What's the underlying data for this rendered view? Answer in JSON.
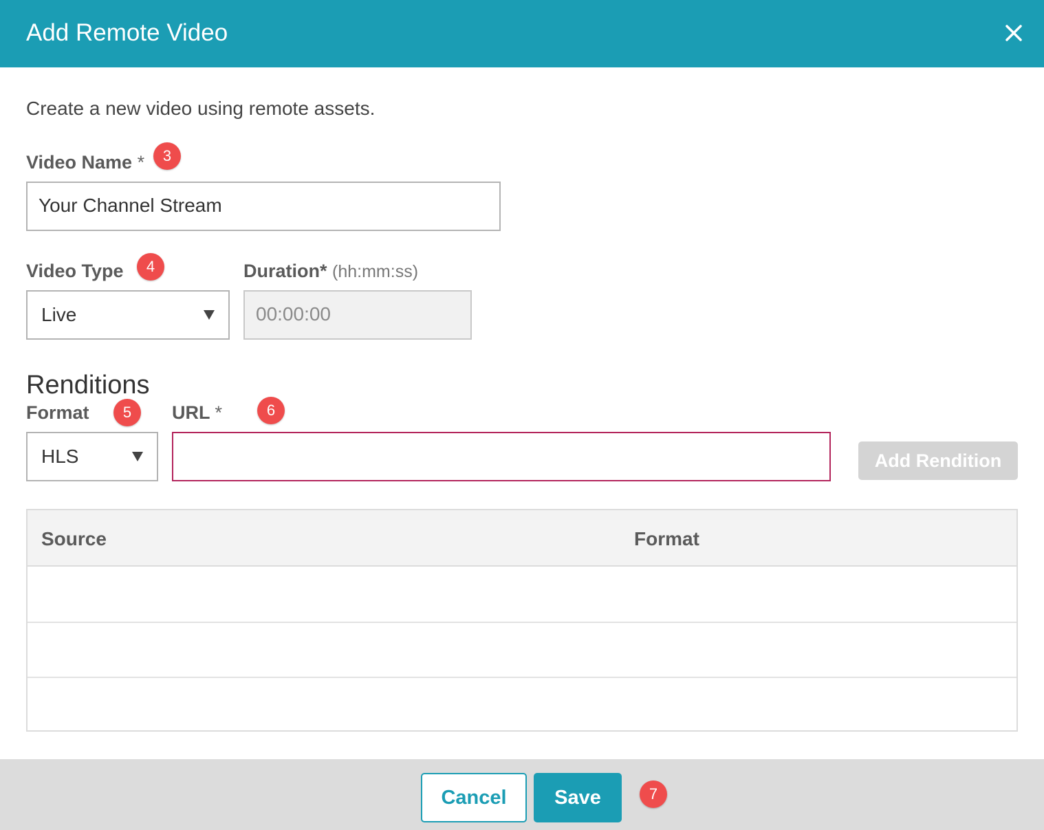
{
  "dialog": {
    "title": "Add Remote Video",
    "close_icon": "close-icon",
    "intro": "Create a new video using remote assets."
  },
  "video_name": {
    "label": "Video Name",
    "required_mark": "*",
    "badge": "3",
    "value": "Your Channel Stream"
  },
  "video_type": {
    "label": "Video Type",
    "badge": "4",
    "selected": "Live"
  },
  "duration": {
    "label": "Duration*",
    "hint": "(hh:mm:ss)",
    "value": "00:00:00"
  },
  "renditions": {
    "title": "Renditions",
    "format_label": "Format",
    "format_badge": "5",
    "format_selected": "HLS",
    "url_label": "URL",
    "url_required_mark": "*",
    "url_badge": "6",
    "url_value": "",
    "add_button": "Add Rendition"
  },
  "table": {
    "columns": [
      "Source",
      "Format"
    ],
    "rows": [
      [
        "",
        ""
      ],
      [
        "",
        ""
      ],
      [
        "",
        ""
      ]
    ]
  },
  "footer": {
    "cancel": "Cancel",
    "save": "Save",
    "badge": "7"
  },
  "colors": {
    "accent": "#1b9db4",
    "badge": "#ef4c4c",
    "invalid_border": "#b3245b"
  }
}
